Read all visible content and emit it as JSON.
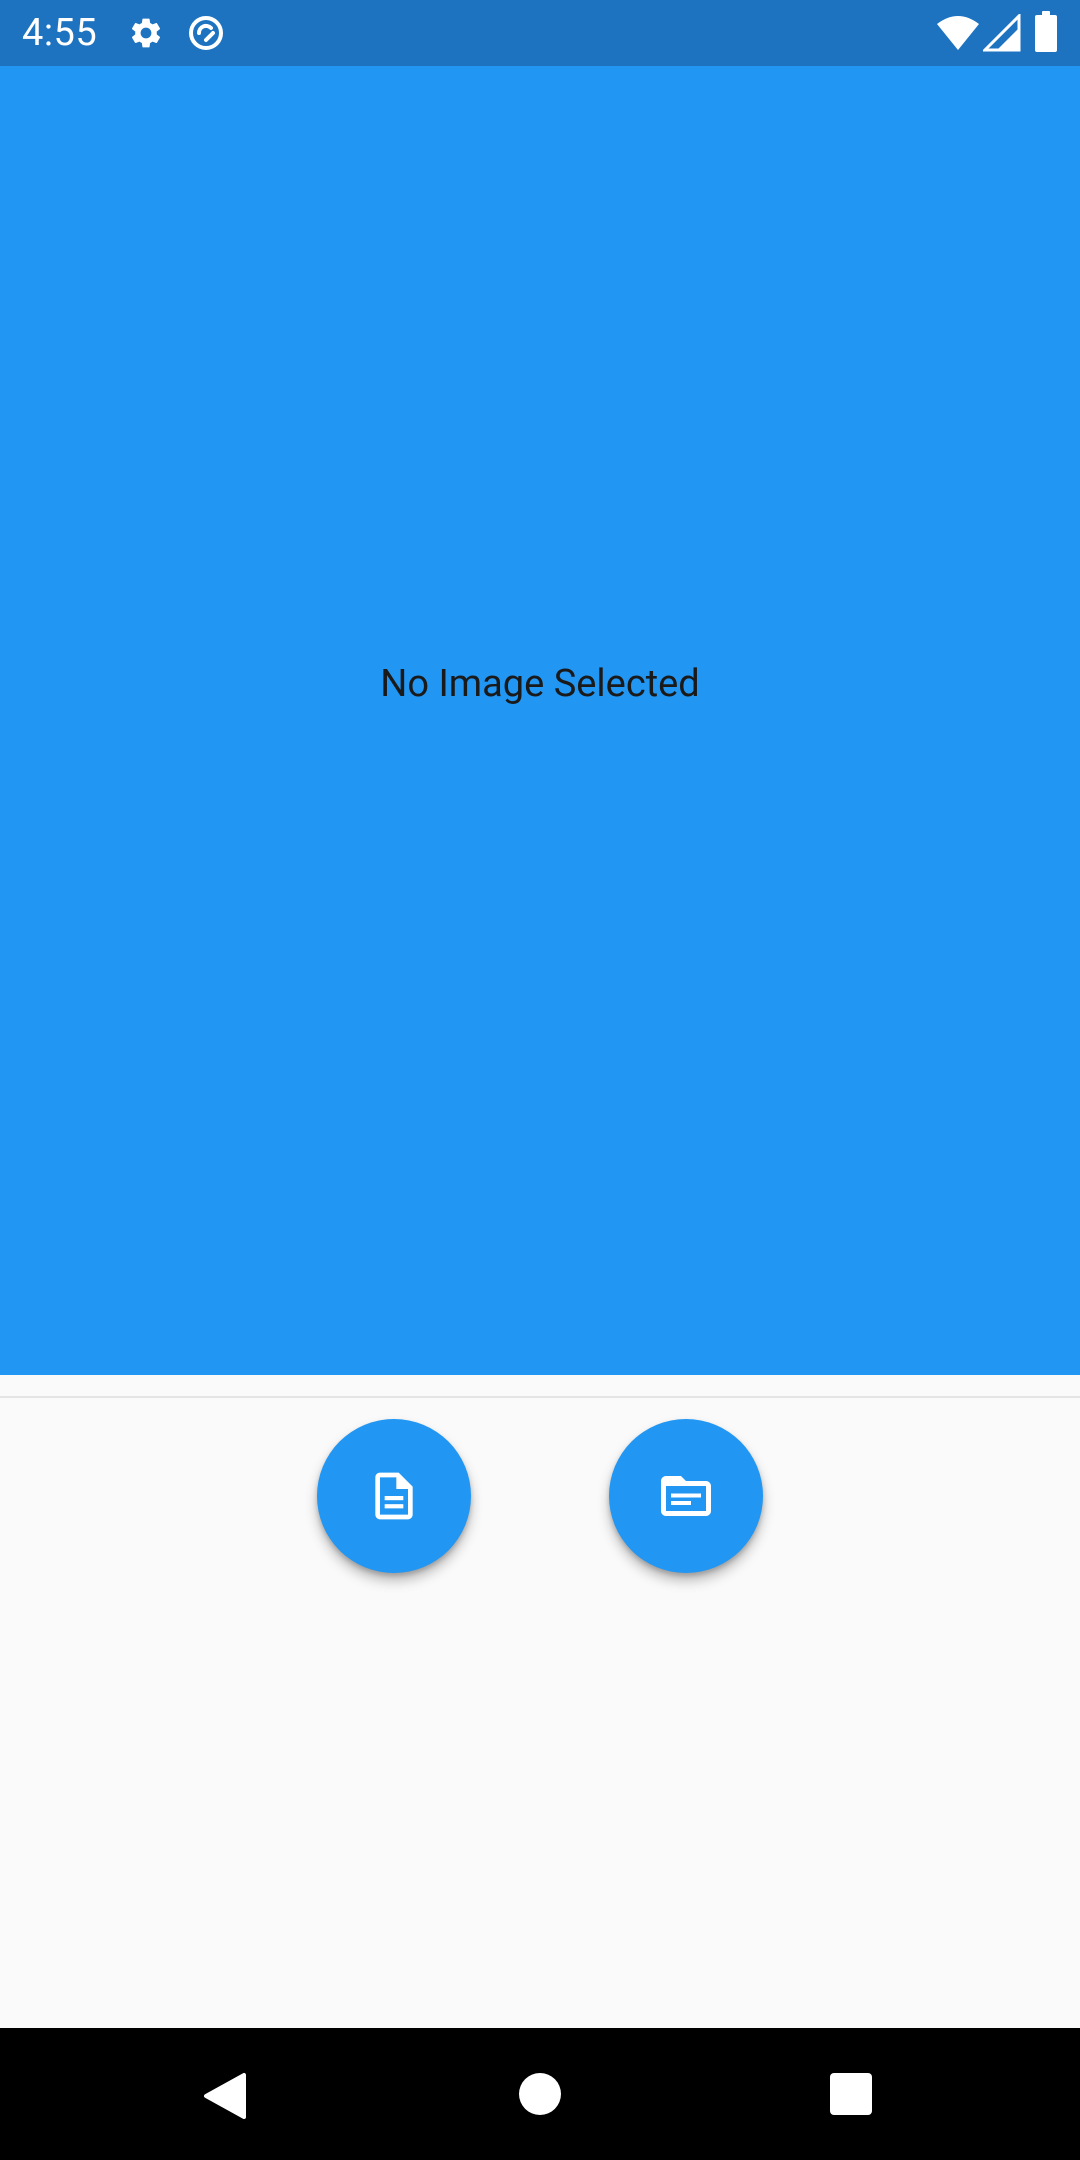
{
  "status_bar": {
    "time": "4:55",
    "left_icons": [
      "gear-icon",
      "sync-icon"
    ],
    "right_icons": [
      "wifi-icon",
      "signal-icon",
      "battery-icon"
    ],
    "background": "#1e73c0"
  },
  "main": {
    "empty_state_text": "No Image Selected",
    "background": "#2196f3"
  },
  "actions": {
    "buttons": [
      {
        "name": "document-button",
        "icon": "document-icon"
      },
      {
        "name": "folder-button",
        "icon": "folder-icon"
      }
    ],
    "accent": "#2196f3"
  },
  "nav_bar": {
    "buttons": [
      "back-icon",
      "home-icon",
      "recents-icon"
    ],
    "background": "#000000"
  }
}
